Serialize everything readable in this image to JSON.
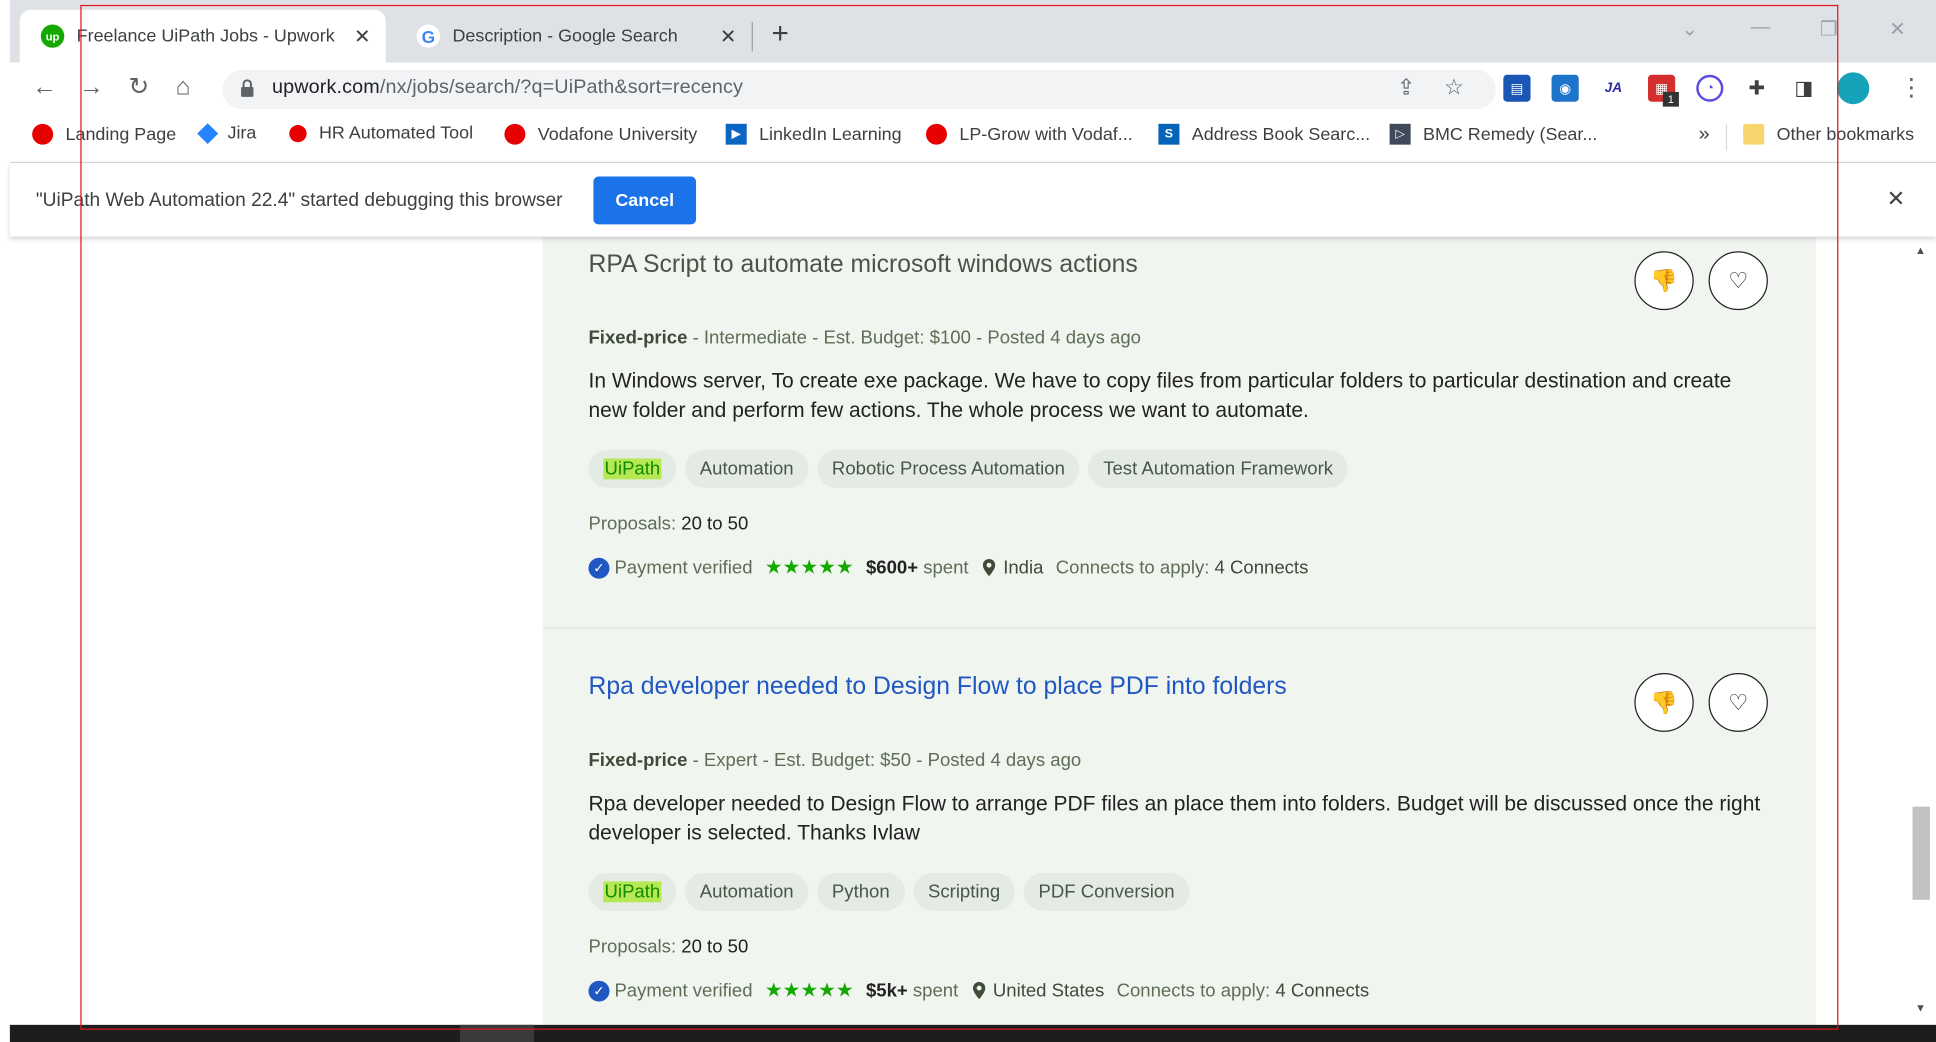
{
  "tabs": [
    {
      "title": "Freelance UiPath Jobs - Upwork",
      "active": true,
      "favicon": "upwork-icon",
      "favicon_text": "up"
    },
    {
      "title": "Description - Google Search",
      "active": false,
      "favicon": "google-icon",
      "favicon_text": "G"
    }
  ],
  "toolbar": {
    "url_host": "upwork.com",
    "url_path": "/nx/jobs/search/?q=UiPath&sort=recency",
    "extension_badge": "1",
    "ext_ja": "JA"
  },
  "bookmarks": [
    {
      "label": "Landing Page",
      "icon": "vodafone-icon"
    },
    {
      "label": "Jira",
      "icon": "jira-icon"
    },
    {
      "label": "HR Automated Tool",
      "icon": "vodafone-icon"
    },
    {
      "label": "Vodafone University",
      "icon": "vodafone-icon"
    },
    {
      "label": "LinkedIn Learning",
      "icon": "linkedin-learning-icon"
    },
    {
      "label": "LP-Grow with Vodaf...",
      "icon": "vodafone-icon"
    },
    {
      "label": "Address Book Searc...",
      "icon": "sharepoint-icon"
    },
    {
      "label": "BMC Remedy (Sear...",
      "icon": "bmc-icon"
    }
  ],
  "bookmarks_overflow": "»",
  "other_bookmarks": "Other bookmarks",
  "debug_bar": {
    "message": "\"UiPath Web Automation 22.4\" started debugging this browser",
    "cancel_label": "Cancel"
  },
  "jobs": [
    {
      "title": "RPA Script to automate microsoft windows actions",
      "type": "Fixed-price",
      "meta_rest": " - Intermediate - Est. Budget: $100 - Posted 4 days ago",
      "description": "In Windows server, To create exe package. We have to copy files from particular folders to particular destination and create new folder and perform few actions. The whole process we want to automate.",
      "skills": [
        "UiPath",
        "Automation",
        "Robotic Process Automation",
        "Test Automation Framework"
      ],
      "proposals_label": "Proposals: ",
      "proposals": "20 to 50",
      "payment": "Payment verified",
      "rating": 4.8,
      "spent_amount": "$600+",
      "spent_label": " spent",
      "location": "India",
      "connects_label": "Connects to apply: ",
      "connects": "4 Connects"
    },
    {
      "title": "Rpa developer needed to Design Flow to place PDF into folders",
      "type": "Fixed-price",
      "meta_rest": " - Expert - Est. Budget: $50 - Posted 4 days ago",
      "description": "Rpa developer needed to Design Flow to arrange PDF files an place them into folders. Budget will be discussed once the right developer is selected. Thanks Ivlaw",
      "skills": [
        "UiPath",
        "Automation",
        "Python",
        "Scripting",
        "PDF Conversion"
      ],
      "proposals_label": "Proposals: ",
      "proposals": "20 to 50",
      "payment": "Payment verified",
      "rating": 5.0,
      "spent_amount": "$5k+",
      "spent_label": " spent",
      "location": "United States",
      "connects_label": "Connects to apply: ",
      "connects": "4 Connects"
    }
  ],
  "colors": {
    "accent": "#1a73e8",
    "upwork_green": "#14a800",
    "job_link": "#1f57c3",
    "highlight": "#b5e853",
    "annotation_box": "#e0161c"
  }
}
